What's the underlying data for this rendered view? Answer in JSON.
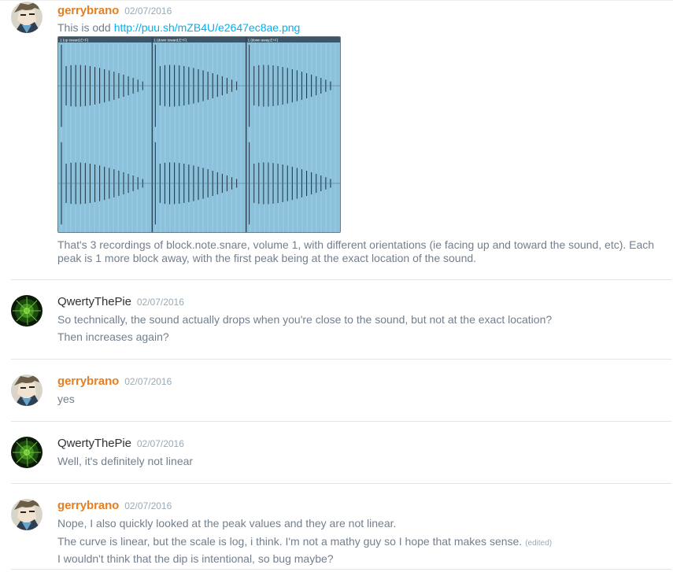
{
  "messages": [
    {
      "author": "gerrybrano",
      "timestamp": "02/07/2016",
      "first_text": "This is odd",
      "link": "http://puu.sh/mZB4U/e2647ec8ae.png",
      "image_panel_labels": [
        "1 (up toward,E+F)",
        "1 (down toward,E+F)",
        "1 (down away,E+F)"
      ],
      "lines": [
        "That's 3 recordings of block.note.snare, volume 1, with different orientations (ie facing up and toward the sound, etc). Each",
        "peak is 1 more block away, with the first peak being at the exact location of the sound."
      ]
    },
    {
      "author": "QwertyThePie",
      "timestamp": "02/07/2016",
      "lines": [
        "So technically, the sound actually drops when you're close to the sound, but not at the exact location?",
        "Then increases again?"
      ]
    },
    {
      "author": "gerrybrano",
      "timestamp": "02/07/2016",
      "lines": [
        "yes"
      ]
    },
    {
      "author": "QwertyThePie",
      "timestamp": "02/07/2016",
      "lines": [
        "Well, it's definitely not linear"
      ]
    },
    {
      "author": "gerrybrano",
      "timestamp": "02/07/2016",
      "lines": [
        "Nope, I also quickly looked at the peak values and they are not linear.",
        "The curve is linear, but the scale is log, i think.  I'm not a mathy guy so I hope that makes sense.",
        "I wouldn't think that the dip is intentional, so bug maybe?"
      ],
      "edited_label": "(edited)"
    }
  ],
  "colors": {
    "author_gerry": "#e67e22",
    "author_qwerty": "#2e3136",
    "link": "#00b0f4",
    "text": "#737f8d",
    "timestamp": "#99aab5"
  }
}
